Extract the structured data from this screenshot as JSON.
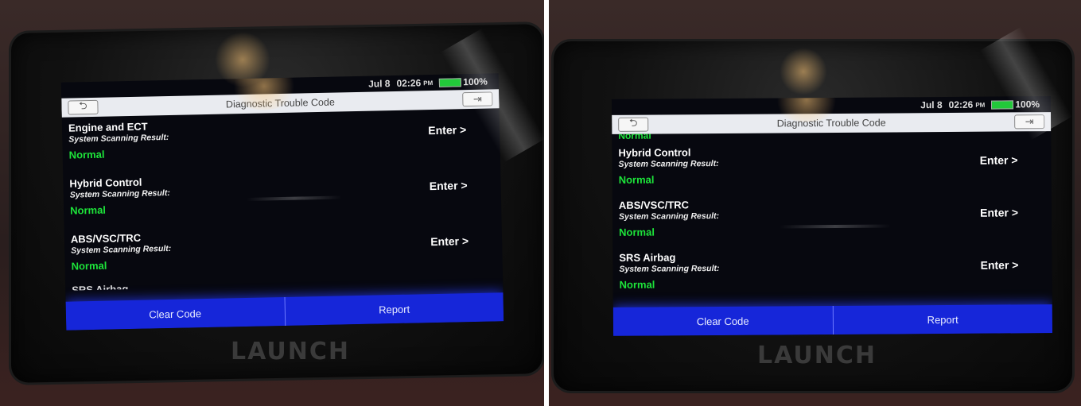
{
  "status": {
    "date": "Jul 8",
    "time": "02:26",
    "ampm": "PM",
    "battery": "100%"
  },
  "header": {
    "title": "Diagnostic Trouble Code"
  },
  "logo": "LAUNCH",
  "labels": {
    "scan_result": "System Scanning Result:",
    "enter": "Enter >"
  },
  "left_screen": {
    "items": [
      {
        "system": "Engine and ECT",
        "result": "Normal"
      },
      {
        "system": "Hybrid Control",
        "result": "Normal"
      },
      {
        "system": "ABS/VSC/TRC",
        "result": "Normal"
      }
    ],
    "partial_next": "SRS Airbag"
  },
  "right_screen": {
    "partial_prev": "Normal",
    "items": [
      {
        "system": "Hybrid Control",
        "result": "Normal"
      },
      {
        "system": "ABS/VSC/TRC",
        "result": "Normal"
      },
      {
        "system": "SRS Airbag",
        "result": "Normal"
      }
    ]
  },
  "footer": {
    "clear_label": "Clear Code",
    "report_label": "Report"
  },
  "colors": {
    "result_green": "#1de43a",
    "footer_blue": "#1626d9",
    "battery_green": "#22c93a"
  }
}
